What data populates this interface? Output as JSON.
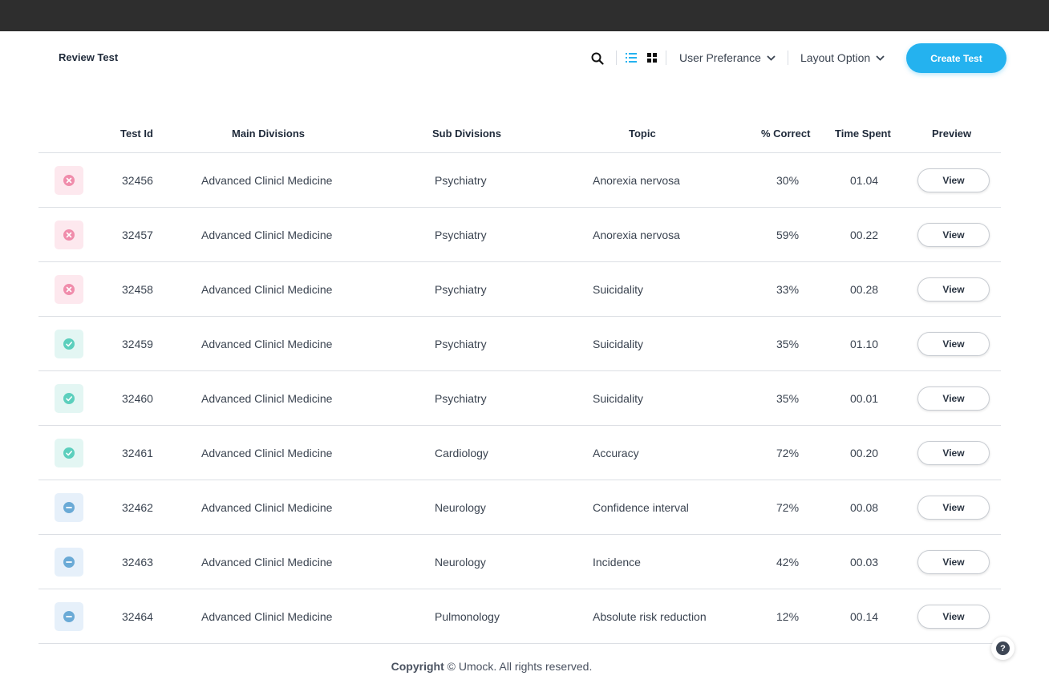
{
  "header": {
    "title": "Review Test",
    "user_preference_label": "User Preferance",
    "layout_option_label": "Layout Option",
    "create_button_label": "Create Test"
  },
  "table": {
    "columns": {
      "test_id": "Test Id",
      "main_divisions": "Main Divisions",
      "sub_divisions": "Sub Divisions",
      "topic": "Topic",
      "correct": "% Correct",
      "time_spent": "Time Spent",
      "preview": "Preview"
    },
    "rows": [
      {
        "status": "failed",
        "test_id": "32456",
        "main_division": "Advanced Clinicl Medicine",
        "sub_division": "Psychiatry",
        "topic": "Anorexia nervosa",
        "correct": "30%",
        "time_spent": "01.04",
        "action": "View"
      },
      {
        "status": "failed",
        "test_id": "32457",
        "main_division": "Advanced Clinicl Medicine",
        "sub_division": "Psychiatry",
        "topic": "Anorexia nervosa",
        "correct": "59%",
        "time_spent": "00.22",
        "action": "View"
      },
      {
        "status": "failed",
        "test_id": "32458",
        "main_division": "Advanced Clinicl Medicine",
        "sub_division": "Psychiatry",
        "topic": "Suicidality",
        "correct": "33%",
        "time_spent": "00.28",
        "action": "View"
      },
      {
        "status": "passed",
        "test_id": "32459",
        "main_division": "Advanced Clinicl Medicine",
        "sub_division": "Psychiatry",
        "topic": "Suicidality",
        "correct": "35%",
        "time_spent": "01.10",
        "action": "View"
      },
      {
        "status": "passed",
        "test_id": "32460",
        "main_division": "Advanced Clinicl Medicine",
        "sub_division": "Psychiatry",
        "topic": "Suicidality",
        "correct": "35%",
        "time_spent": "00.01",
        "action": "View"
      },
      {
        "status": "passed",
        "test_id": "32461",
        "main_division": "Advanced Clinicl Medicine",
        "sub_division": "Cardiology",
        "topic": "Accuracy",
        "correct": "72%",
        "time_spent": "00.20",
        "action": "View"
      },
      {
        "status": "omitted",
        "test_id": "32462",
        "main_division": "Advanced Clinicl Medicine",
        "sub_division": "Neurology",
        "topic": "Confidence interval",
        "correct": "72%",
        "time_spent": "00.08",
        "action": "View"
      },
      {
        "status": "omitted",
        "test_id": "32463",
        "main_division": "Advanced Clinicl Medicine",
        "sub_division": "Neurology",
        "topic": "Incidence",
        "correct": "42%",
        "time_spent": "00.03",
        "action": "View"
      },
      {
        "status": "omitted",
        "test_id": "32464",
        "main_division": "Advanced Clinicl Medicine",
        "sub_division": "Pulmonology",
        "topic": "Absolute risk reduction",
        "correct": "12%",
        "time_spent": "00.14",
        "action": "View"
      }
    ]
  },
  "status_styles": {
    "failed": {
      "icon": "x-circle-icon",
      "color": "#f08cab"
    },
    "passed": {
      "icon": "check-circle-icon",
      "color": "#5ccfbd"
    },
    "omitted": {
      "icon": "minus-circle-icon",
      "color": "#6aaad6"
    }
  },
  "footer": {
    "copyright_bold": "Copyright",
    "copyright_rest": "© Umock. All rights reserved.",
    "help_label": "?"
  },
  "colors": {
    "topbar": "#2e2e2e",
    "accent": "#24b2ef"
  }
}
